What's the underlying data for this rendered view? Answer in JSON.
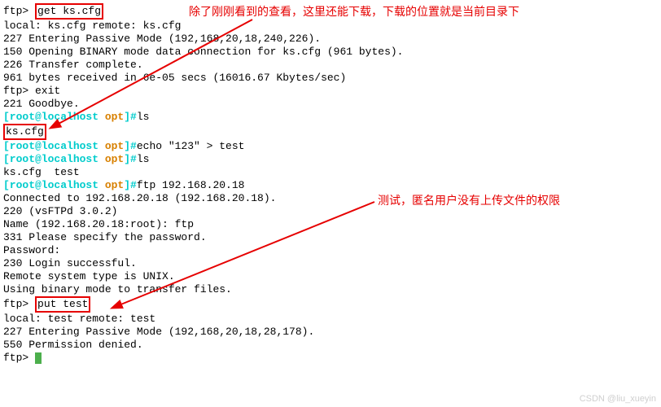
{
  "lines": {
    "l1_prompt": "ftp> ",
    "l1_cmd": "get ks.cfg",
    "l2": "local: ks.cfg remote: ks.cfg",
    "l3": "227 Entering Passive Mode (192,168,20,18,240,226).",
    "l4": "150 Opening BINARY mode data connection for ks.cfg (961 bytes).",
    "l5": "226 Transfer complete.",
    "l6": "961 bytes received in 6e-05 secs (16016.67 Kbytes/sec)",
    "l7": "ftp> exit",
    "l8": "221 Goodbye.",
    "l9_user": "[root@localhost ",
    "l9_dir": "opt",
    "l9_end": "]#",
    "l9_cmd": "ls",
    "l10": "ks.cfg",
    "l11_cmd": "echo \"123\" > test",
    "l12_cmd": "ls",
    "l13": "ks.cfg  test",
    "l14_cmd": "ftp 192.168.20.18",
    "l15": "Connected to 192.168.20.18 (192.168.20.18).",
    "l16": "220 (vsFTPd 3.0.2)",
    "l17": "Name (192.168.20.18:root): ftp",
    "l18": "331 Please specify the password.",
    "l19": "Password:",
    "l20": "230 Login successful.",
    "l21": "Remote system type is UNIX.",
    "l22": "Using binary mode to transfer files.",
    "l23_prompt": "ftp> ",
    "l23_cmd": "put test",
    "l24": "local: test remote: test",
    "l25": "227 Entering Passive Mode (192,168,20,18,28,178).",
    "l26": "550 Permission denied.",
    "l27": "ftp> "
  },
  "annotations": {
    "a1": "除了刚刚看到的查看，这里还能下载，下载的位置就是当前目录下",
    "a2": "测试，匿名用户没有上传文件的权限"
  },
  "watermark": "CSDN @liu_xueyin"
}
